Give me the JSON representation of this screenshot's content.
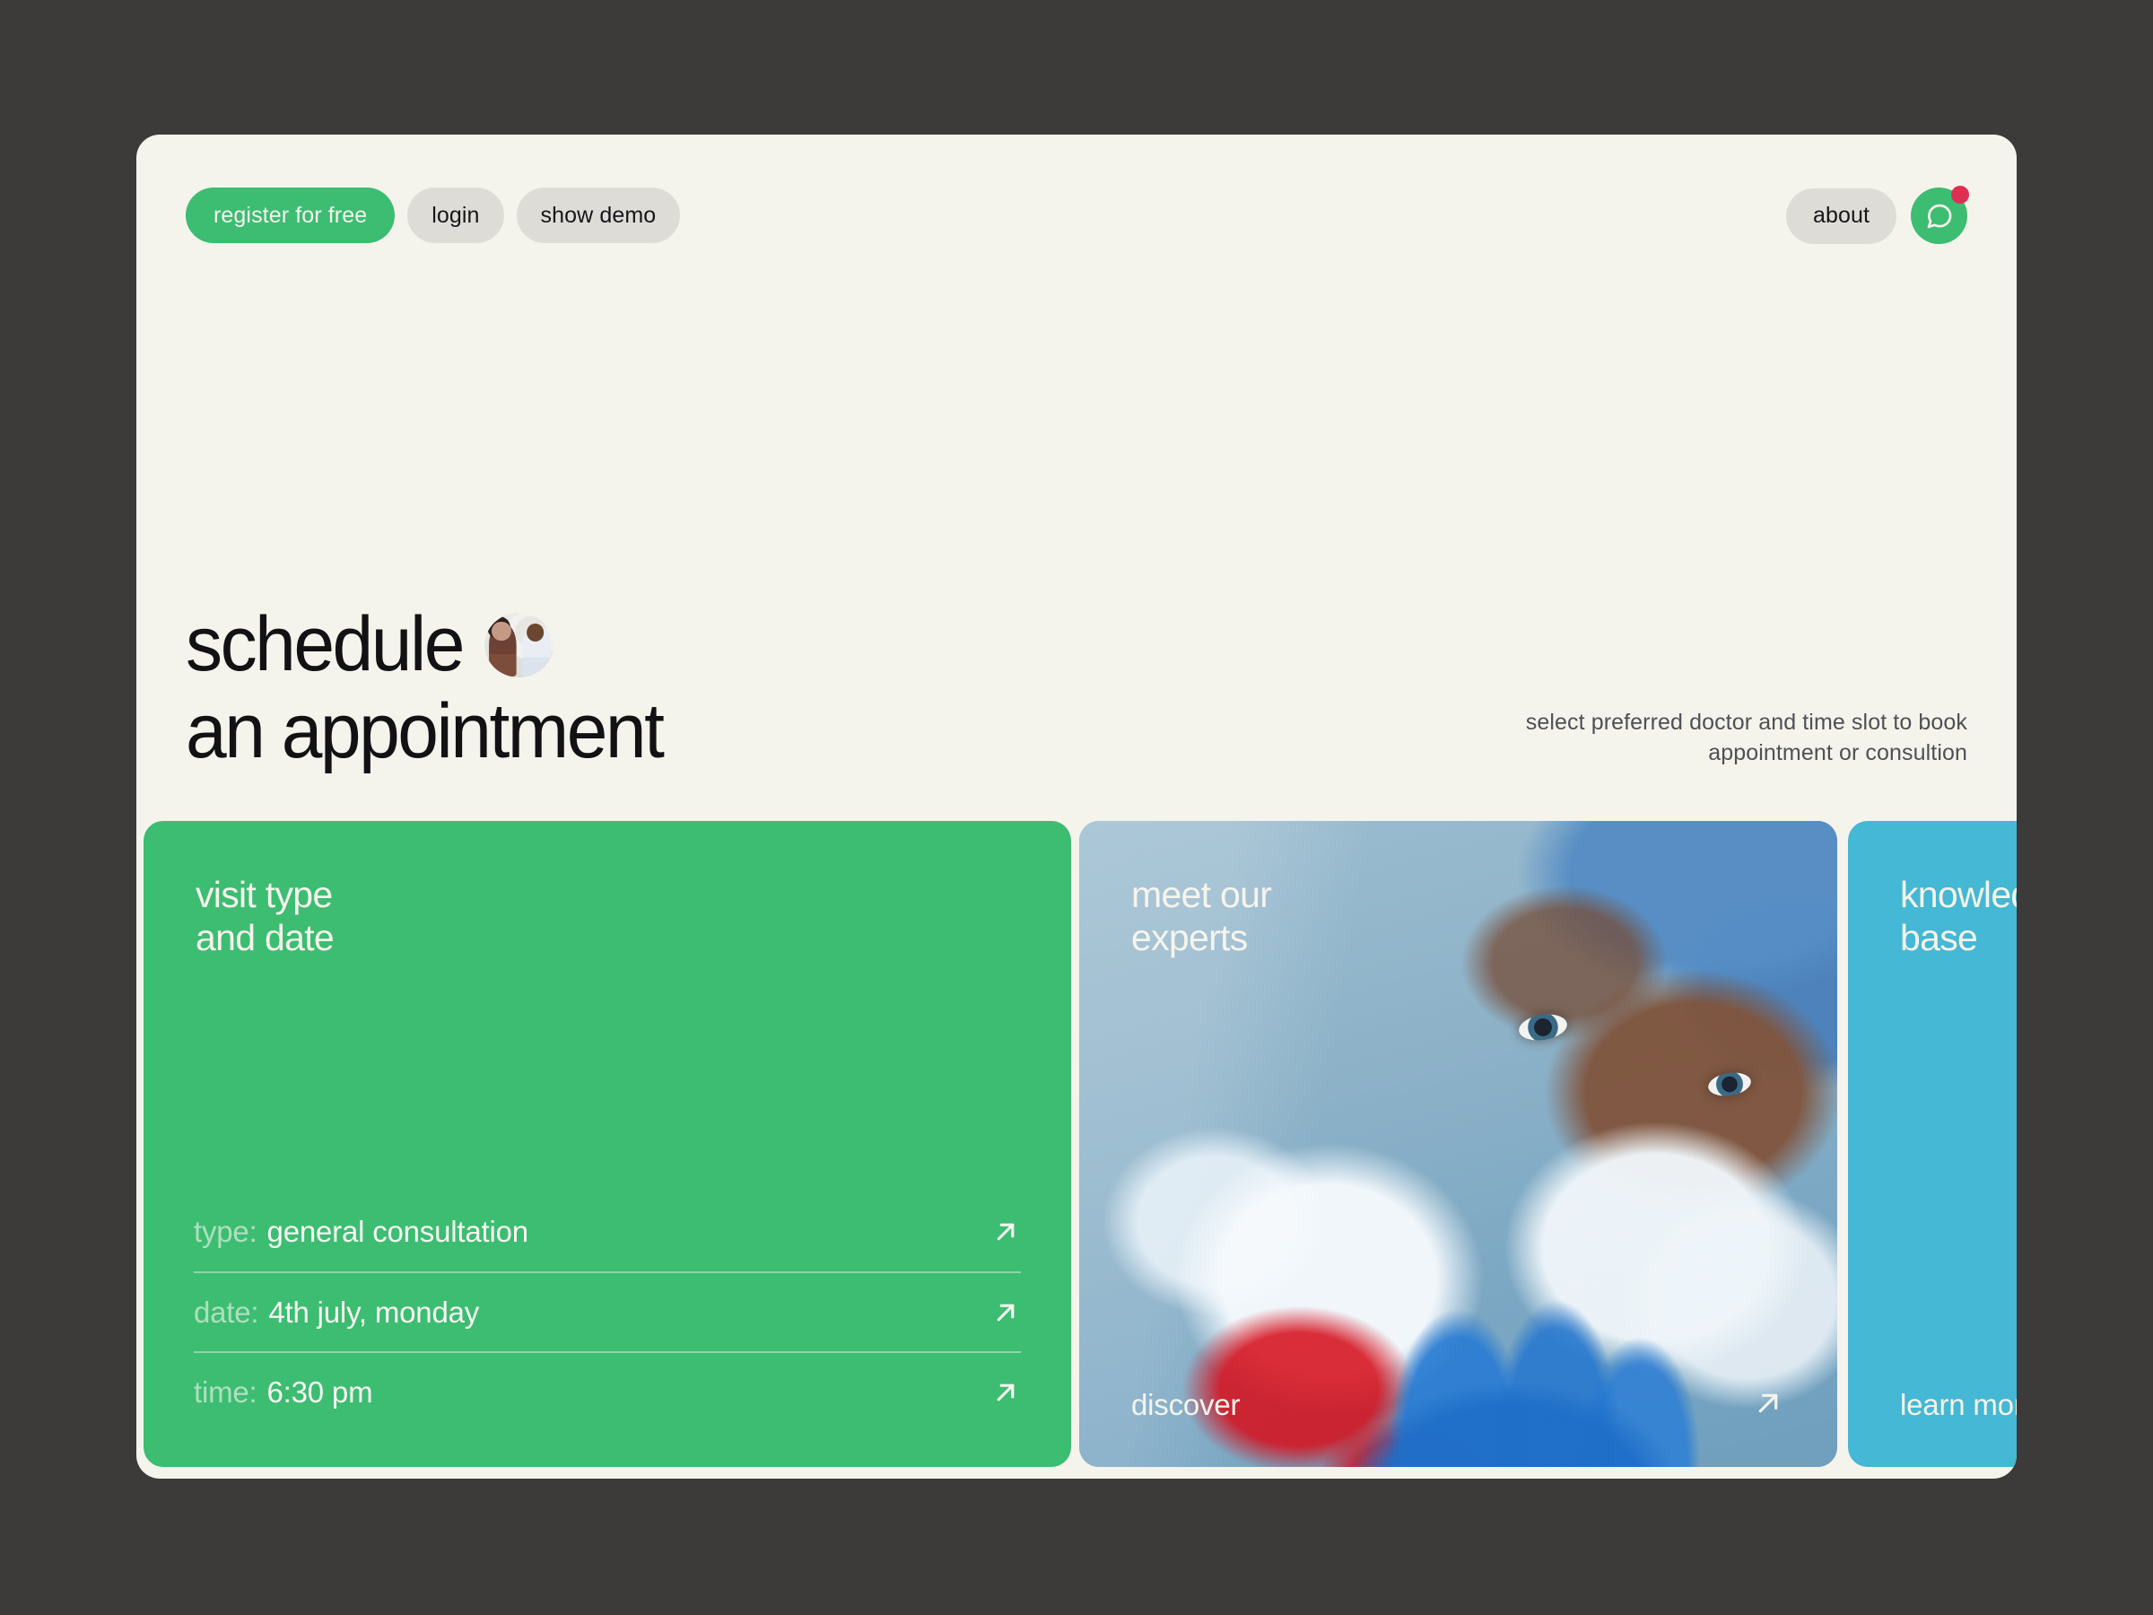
{
  "theme": {
    "page_background": "#3d3b39",
    "window_background": "#f5f4ec",
    "accent_green": "#3cbd72",
    "accent_cyan": "#44b8d4",
    "pill_grey": "#dedcd6",
    "notification_red": "#de2f52",
    "text_dark": "#121214",
    "text_muted": "#4f5053"
  },
  "nav": {
    "register_label": "register for free",
    "login_label": "login",
    "demo_label": "show demo",
    "about_label": "about",
    "chat_icon": "chat-bubble-icon",
    "notification_badge": ""
  },
  "hero": {
    "headline_line1": "schedule",
    "headline_line2": "an appointment",
    "inline_image": "doctor-and-patient-photo",
    "subtitle_line1": "select preferred doctor and time slot to book",
    "subtitle_line2": "appointment or consultion"
  },
  "cards": {
    "visit": {
      "title": "visit type\nand date",
      "rows": [
        {
          "label": "type:",
          "value": "general consultation",
          "arrow": "arrow-up-right-icon"
        },
        {
          "label": "date:",
          "value": "4th july, monday",
          "arrow": "arrow-up-right-icon"
        },
        {
          "label": "time:",
          "value": "6:30 pm",
          "arrow": "arrow-up-right-icon"
        }
      ]
    },
    "experts": {
      "title": "meet our\nexperts",
      "cta": "discover",
      "arrow": "arrow-up-right-icon",
      "image": "surgeon-holding-blood-bag-photo"
    },
    "knowledge": {
      "title": "knowledge\nbase",
      "cta": "learn more",
      "arrow": "arrow-up-right-icon"
    }
  }
}
